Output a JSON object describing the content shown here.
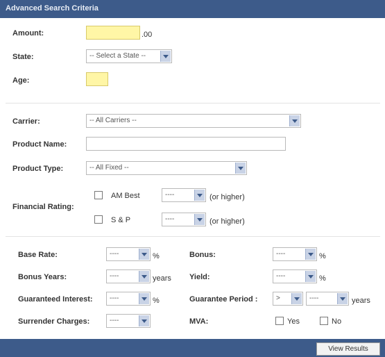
{
  "panel": {
    "title": "Advanced Search Criteria"
  },
  "labels": {
    "amount": "Amount:",
    "state": "State:",
    "age": "Age:",
    "carrier": "Carrier:",
    "product_name": "Product Name:",
    "product_type": "Product Type:",
    "financial_rating": "Financial Rating:",
    "base_rate": "Base Rate:",
    "bonus": "Bonus:",
    "bonus_years": "Bonus Years:",
    "yield": "Yield:",
    "guaranteed_interest": "Guaranteed Interest:",
    "guarantee_period": "Guarantee Period :",
    "surrender_charges": "Surrender Charges:",
    "mva": "MVA:"
  },
  "fields": {
    "amount_value": "",
    "amount_suffix": ".00",
    "state_selected": "-- Select a State --",
    "age_value": "",
    "carrier_selected": "-- All Carriers --",
    "product_name_value": "",
    "product_type_selected": "-- All Fixed --",
    "am_best_label": "AM Best",
    "sp_label": "S & P",
    "rating_selected": "----",
    "or_higher": "(or higher)",
    "small_selected": "----",
    "guarantee_op_selected": ">",
    "percent": "%",
    "years": "years",
    "mva_yes": "Yes",
    "mva_no": "No"
  },
  "footer": {
    "view_results": "View Results"
  }
}
